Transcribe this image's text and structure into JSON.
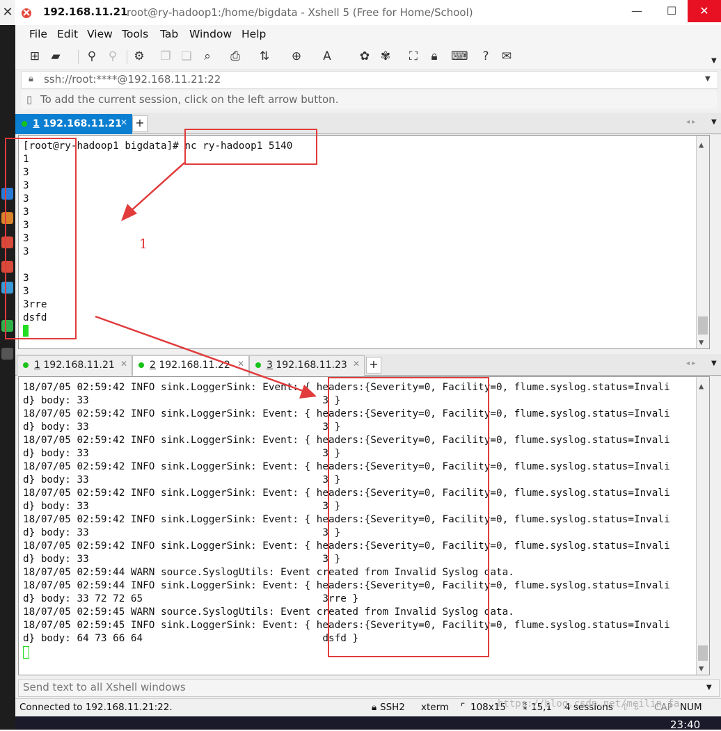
{
  "window": {
    "host": "192.168.11.21",
    "title": "root@ry-hadoop1:/home/bigdata - Xshell 5 (Free for Home/School)",
    "minimize": "—",
    "maximize": "☐",
    "close": "✕"
  },
  "desktop": {
    "close_glyph": "✕"
  },
  "menu": [
    "File",
    "Edit",
    "View",
    "Tools",
    "Tab",
    "Window",
    "Help"
  ],
  "address_bar": {
    "text": "ssh://root:****@192.168.11.21:22"
  },
  "session_hint": {
    "text": "To add the current session, click on the left arrow button."
  },
  "top_tabs": [
    {
      "num": "1",
      "label": "192.168.11.21"
    }
  ],
  "top_terminal": {
    "prompt": "[root@ry-hadoop1 bigdata]#",
    "command": " nc ry-hadoop1 5140",
    "lines": [
      "1",
      "3",
      "3",
      "3",
      "3",
      "3",
      "3",
      "3",
      "",
      "3",
      "3",
      "3rre",
      "dsfd"
    ]
  },
  "bottom_tabs": [
    {
      "num": "1",
      "label": "192.168.11.21"
    },
    {
      "num": "2",
      "label": "192.168.11.22"
    },
    {
      "num": "3",
      "label": "192.168.11.23"
    }
  ],
  "bottom_terminal": {
    "lines": [
      "18/07/05 02:59:42 INFO sink.LoggerSink: Event: { headers:{Severity=0, Facility=0, flume.syslog.status=Invali",
      "d} body: 33                                       3 }",
      "18/07/05 02:59:42 INFO sink.LoggerSink: Event: { headers:{Severity=0, Facility=0, flume.syslog.status=Invali",
      "d} body: 33                                       3 }",
      "18/07/05 02:59:42 INFO sink.LoggerSink: Event: { headers:{Severity=0, Facility=0, flume.syslog.status=Invali",
      "d} body: 33                                       3 }",
      "18/07/05 02:59:42 INFO sink.LoggerSink: Event: { headers:{Severity=0, Facility=0, flume.syslog.status=Invali",
      "d} body: 33                                       3 }",
      "18/07/05 02:59:42 INFO sink.LoggerSink: Event: { headers:{Severity=0, Facility=0, flume.syslog.status=Invali",
      "d} body: 33                                       3 }",
      "18/07/05 02:59:42 INFO sink.LoggerSink: Event: { headers:{Severity=0, Facility=0, flume.syslog.status=Invali",
      "d} body: 33                                       3 }",
      "18/07/05 02:59:42 INFO sink.LoggerSink: Event: { headers:{Severity=0, Facility=0, flume.syslog.status=Invali",
      "d} body: 33                                       3 }",
      "18/07/05 02:59:44 WARN source.SyslogUtils: Event created from Invalid Syslog data.",
      "18/07/05 02:59:44 INFO sink.LoggerSink: Event: { headers:{Severity=0, Facility=0, flume.syslog.status=Invali",
      "d} body: 33 72 72 65                              3rre }",
      "18/07/05 02:59:45 WARN source.SyslogUtils: Event created from Invalid Syslog data.",
      "18/07/05 02:59:45 INFO sink.LoggerSink: Event: { headers:{Severity=0, Facility=0, flume.syslog.status=Invali",
      "d} body: 64 73 66 64                              dsfd }"
    ]
  },
  "send_bar": {
    "text": "Send text to all Xshell windows"
  },
  "status_bar": {
    "connection": "Connected to 192.168.11.21:22.",
    "protocol": "SSH2",
    "terminal": "xterm",
    "size": "108x15",
    "cursor": "15,1",
    "sessions": "4 sessions",
    "caps": "CAP",
    "num": "NUM"
  },
  "annotation": {
    "label": "1"
  },
  "watermark": "https://blog.csdn.net/meilin_fa",
  "clock": "23:40",
  "colors": {
    "accent_tab": "#0a7fd1",
    "annotation": "#e13b3b",
    "cursor": "#22dd22",
    "close": "#e81123"
  }
}
